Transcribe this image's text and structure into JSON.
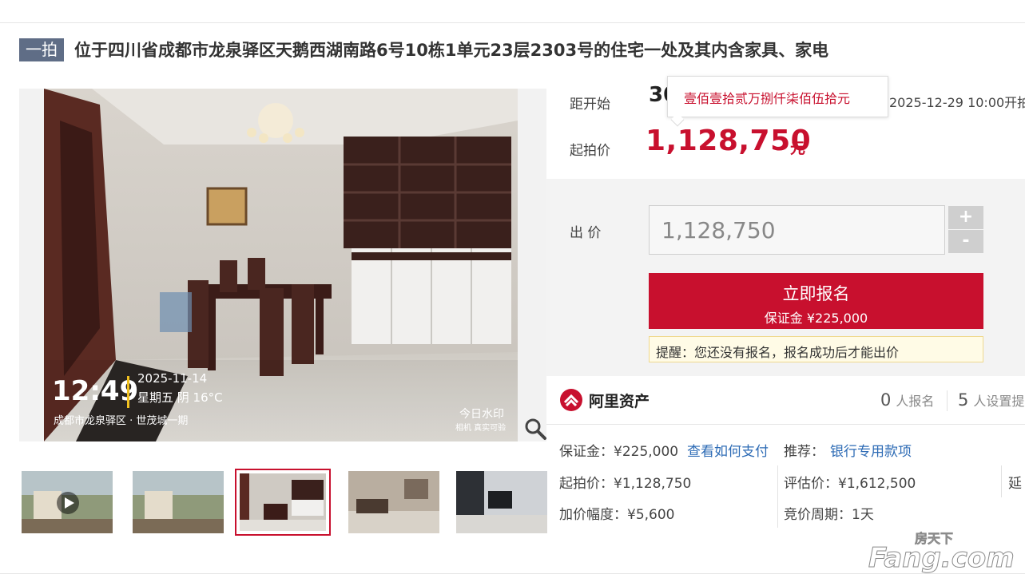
{
  "listing": {
    "badge": "一拍",
    "title": "位于四川省成都市龙泉驿区天鹅西湖南路6号10栋1单元23层2303号的住宅一处及其内含家具、家电"
  },
  "photo": {
    "time": "12:49",
    "date": "2025-11-14",
    "weekday_weather": "星期五  阴 16°C",
    "location": "成都市龙泉驿区 · 世茂城一期",
    "watermark_app": "今日水印",
    "watermark_sub": "相机 真实可验"
  },
  "auction": {
    "countdown_label": "距开始",
    "countdown_value": "30",
    "start_time": "2025-12-29 10:00开拍",
    "start_price_label": "起拍价",
    "start_price": "1,128,750",
    "currency_unit": "元",
    "tooltip": "壹佰壹拾贰万捌仟柒佰伍拾元"
  },
  "bid": {
    "label": "出  价",
    "value": "1,128,750",
    "plus": "+",
    "minus": "-",
    "apply_label": "立即报名",
    "deposit_line": "保证金 ¥225,000",
    "reminder": "提醒：您还没有报名，报名成功后才能出价"
  },
  "org": {
    "name": "阿里资产",
    "registered_count": "0",
    "registered_label": "人报名",
    "reminder_count": "5",
    "reminder_label": "人设置提"
  },
  "details": {
    "deposit": "保证金：¥225,000",
    "how_to_pay": "查看如何支付",
    "recommend_label": "推荐：",
    "bank_account": "银行专用款项",
    "start_price": "起拍价：¥1,128,750",
    "appraisal": "评估价：¥1,612,500",
    "extend_cut": "延",
    "increment": "加价幅度：¥5,600",
    "cycle": "竞价周期：1天"
  },
  "site_watermark": {
    "cn": "房天下",
    "en": "Fang.com"
  },
  "colors": {
    "brand_red": "#c8102e",
    "badge_bg": "#5f6d86",
    "link_blue": "#2d6bb5"
  }
}
